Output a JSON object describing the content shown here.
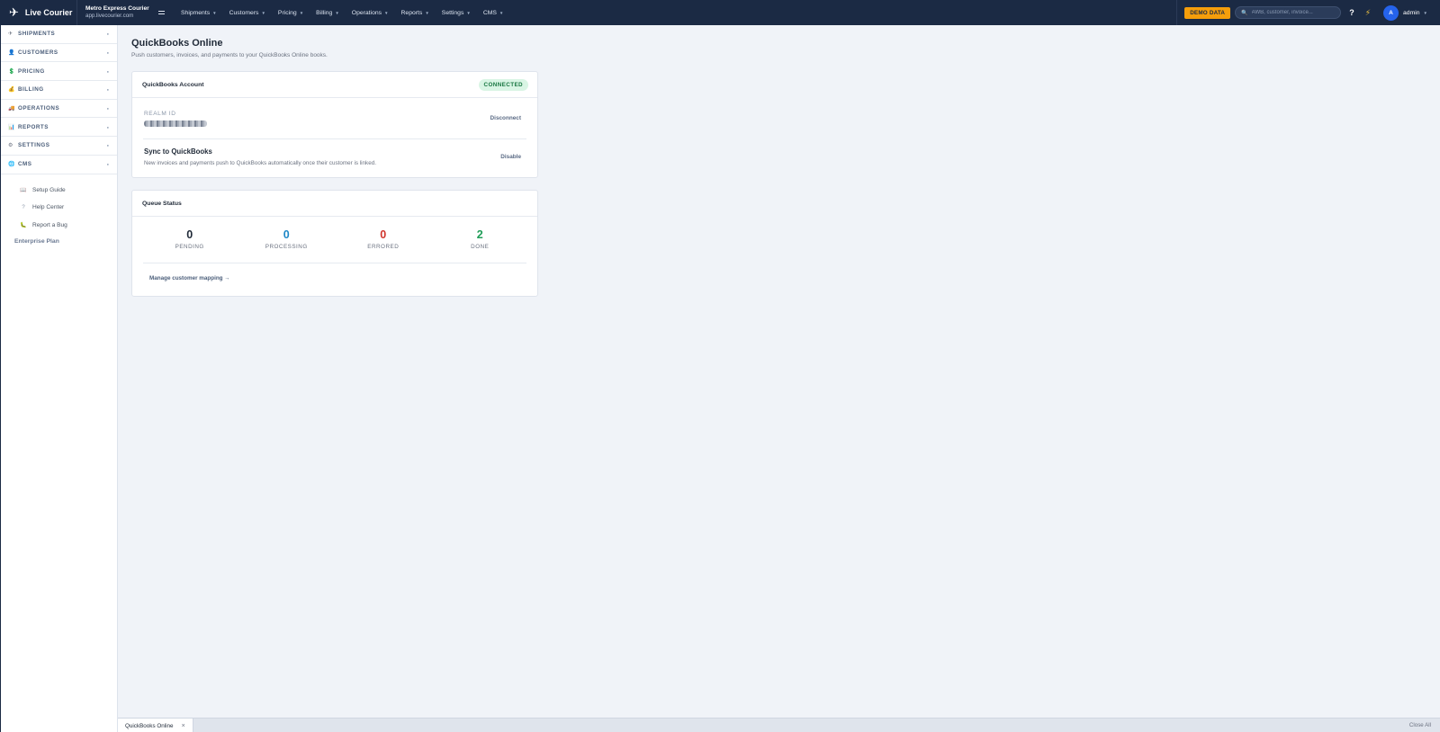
{
  "topbar": {
    "brand": "Live Courier",
    "org_name": "Metro Express Courier",
    "org_domain": "app.livecourier.com",
    "nav": [
      {
        "label": "Shipments"
      },
      {
        "label": "Customers"
      },
      {
        "label": "Pricing"
      },
      {
        "label": "Billing"
      },
      {
        "label": "Operations"
      },
      {
        "label": "Reports"
      },
      {
        "label": "Settings"
      },
      {
        "label": "CMS"
      }
    ],
    "demo_badge": "DEMO DATA",
    "search_placeholder": "AWB, customer, invoice...",
    "help": "?",
    "avatar_initial": "A",
    "user": "admin"
  },
  "sidebar": {
    "sections": [
      {
        "label": "SHIPMENTS",
        "icon": "plane-icon"
      },
      {
        "label": "CUSTOMERS",
        "icon": "person-icon"
      },
      {
        "label": "PRICING",
        "icon": "dollar-icon"
      },
      {
        "label": "BILLING",
        "icon": "money-bag-icon"
      },
      {
        "label": "OPERATIONS",
        "icon": "truck-icon"
      },
      {
        "label": "REPORTS",
        "icon": "chart-icon"
      },
      {
        "label": "SETTINGS",
        "icon": "gear-icon"
      },
      {
        "label": "CMS",
        "icon": "globe-icon"
      }
    ],
    "links": [
      {
        "label": "Setup Guide",
        "icon": "book-icon"
      },
      {
        "label": "Help Center",
        "icon": "question-icon"
      },
      {
        "label": "Report a Bug",
        "icon": "bug-icon"
      }
    ],
    "plan": "Enterprise Plan"
  },
  "page": {
    "title": "QuickBooks Online",
    "subtitle": "Push customers, invoices, and payments to your QuickBooks Online books."
  },
  "account_card": {
    "title": "QuickBooks Account",
    "status": "CONNECTED",
    "realm_label": "REALM ID",
    "disconnect": "Disconnect",
    "sync_title": "Sync to QuickBooks",
    "sync_desc": "New invoices and payments push to QuickBooks automatically once their customer is linked.",
    "disable": "Disable"
  },
  "queue_card": {
    "title": "Queue Status",
    "stats": [
      {
        "value": "0",
        "label": "PENDING",
        "color": "#1f2937"
      },
      {
        "value": "0",
        "label": "PROCESSING",
        "color": "#1e88c7"
      },
      {
        "value": "0",
        "label": "ERRORED",
        "color": "#d0342c"
      },
      {
        "value": "2",
        "label": "DONE",
        "color": "#1f9d57"
      }
    ],
    "manage_link": "Manage customer mapping →"
  },
  "tabbar": {
    "active_tab": "QuickBooks Online",
    "close_all": "Close All"
  }
}
